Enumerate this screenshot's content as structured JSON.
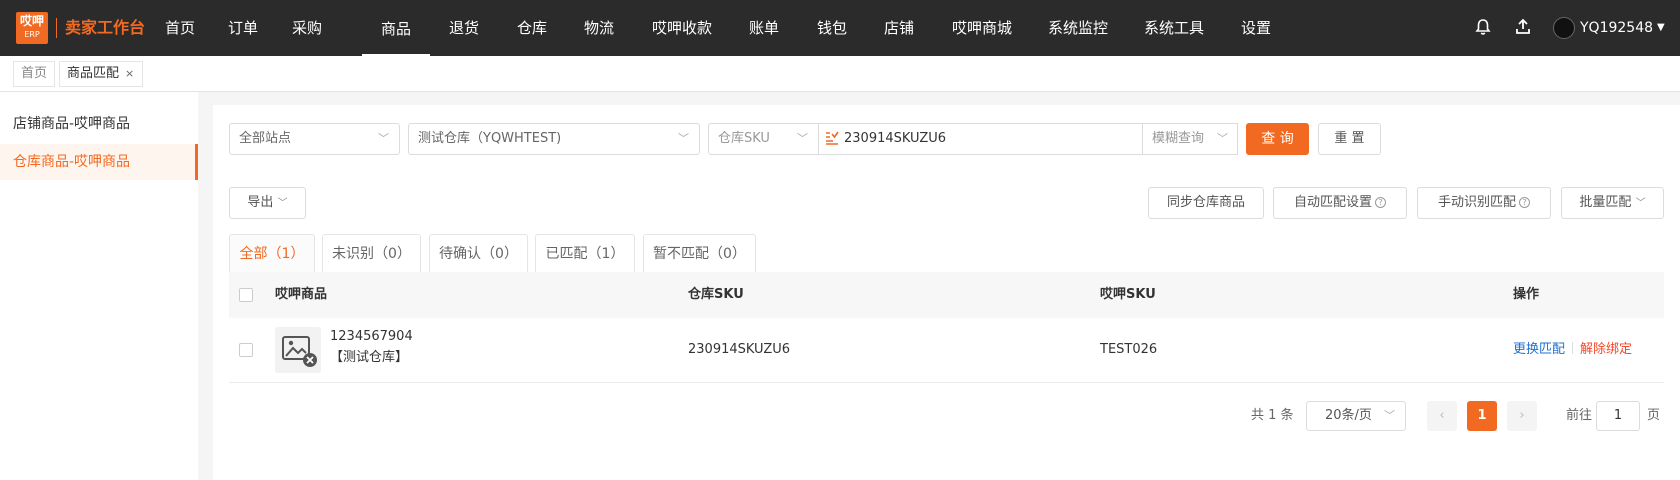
{
  "brand": {
    "logo_line1": "哎呷",
    "logo_line2": "ERP",
    "title": "卖家工作台"
  },
  "nav": {
    "items": [
      "首页",
      "订单",
      "采购",
      "商品",
      "退货",
      "仓库",
      "物流",
      "哎呷收款",
      "账单",
      "钱包",
      "店铺",
      "哎呷商城",
      "系统监控",
      "系统工具",
      "设置"
    ],
    "active_index": 3
  },
  "user": {
    "name": "YQ192548"
  },
  "tabs": {
    "home": "首页",
    "current": "商品匹配",
    "close": "×"
  },
  "sidebar": {
    "items": [
      "店铺商品-哎呷商品",
      "仓库商品-哎呷商品"
    ],
    "active_index": 1
  },
  "filters": {
    "site": "全部站点",
    "warehouse": "测试仓库（YQWHTEST)",
    "sku_type": "仓库SKU",
    "search_value": "230914SKUZU6",
    "match_mode": "模糊查询",
    "query_button": "查 询",
    "reset_button": "重 置"
  },
  "toolbar": {
    "export": "导出",
    "sync": "同步仓库商品",
    "auto_match": "自动匹配设置",
    "manual_match": "手动识别匹配",
    "batch_match": "批量匹配"
  },
  "status_tabs": [
    "全部（1）",
    "未识别（0）",
    "待确认（0）",
    "已匹配（1）",
    "暂不匹配（0）"
  ],
  "table": {
    "headers": {
      "product": "哎呷商品",
      "warehouse_sku": "仓库SKU",
      "aiya_sku": "哎呷SKU",
      "actions": "操作"
    },
    "rows": [
      {
        "product_id": "1234567904",
        "warehouse_tag": "【测试仓库】",
        "warehouse_sku": "230914SKUZU6",
        "aiya_sku": "TEST026",
        "action_change": "更换匹配",
        "action_unbind": "解除绑定"
      }
    ]
  },
  "pagination": {
    "total": "共 1 条",
    "page_size": "20条/页",
    "current_page": "1",
    "goto_label": "前往",
    "goto_value": "1",
    "page_suffix": "页"
  },
  "colors": {
    "accent": "#f26a21",
    "nav_bg": "#2b2b2b",
    "link_blue": "#1f6fd1",
    "link_red": "#f5472a"
  }
}
